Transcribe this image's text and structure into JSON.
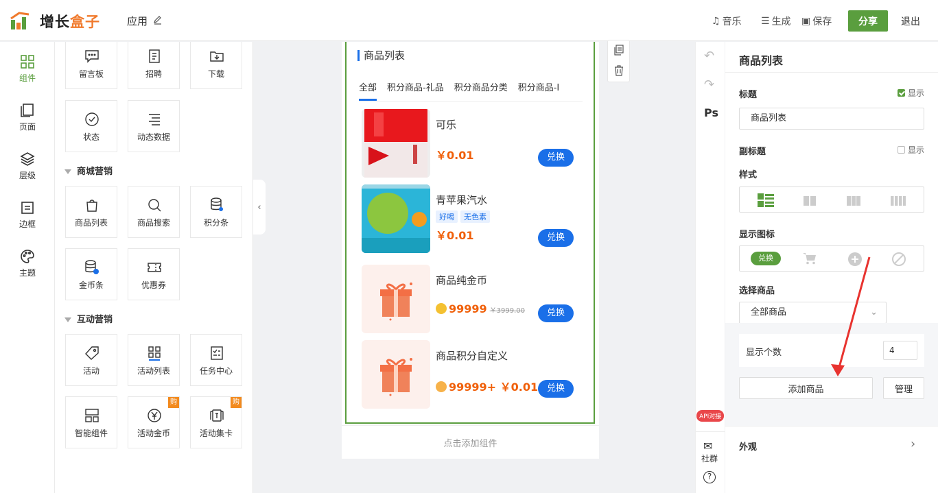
{
  "header": {
    "brand_part1": "增长",
    "brand_part2": "盒子",
    "app_name": "应用",
    "music": "音乐",
    "generate": "生成",
    "save": "保存",
    "share": "分享",
    "exit": "退出"
  },
  "leftnav": {
    "items": [
      {
        "label": "组件"
      },
      {
        "label": "页面"
      },
      {
        "label": "层级"
      },
      {
        "label": "边框"
      },
      {
        "label": "主题"
      }
    ]
  },
  "components": {
    "top": [
      "留言板",
      "招聘",
      "下载",
      "状态",
      "动态数据"
    ],
    "mall_title": "商城营销",
    "mall": [
      "商品列表",
      "商品搜索",
      "积分条",
      "金币条",
      "优惠券"
    ],
    "interact_title": "互动营销",
    "interact": [
      "活动",
      "活动列表",
      "任务中心",
      "智能组件",
      "活动金币",
      "活动集卡"
    ],
    "buy_badge": "购"
  },
  "preview": {
    "title": "商品列表",
    "tabs": [
      "全部",
      "积分商品-礼品",
      "积分商品分类",
      "积分商品-I"
    ],
    "products": [
      {
        "name": "可乐",
        "price": "￥0.01",
        "button": "兑换"
      },
      {
        "name": "青苹果汽水",
        "tags": [
          "好喝",
          "无色素"
        ],
        "price": "￥0.01",
        "button": "兑换"
      },
      {
        "name": "商品纯金币",
        "price": "99999",
        "original": "￥3999.00",
        "button": "兑换"
      },
      {
        "name": "商品积分自定义",
        "price": "99999",
        "price_extra": "+ ￥0.01",
        "button": "兑换"
      }
    ],
    "add_component": "点击添加组件"
  },
  "rightstrip": {
    "ps": "Ps",
    "api": "API对接",
    "community": "社群"
  },
  "props": {
    "panel_title": "商品列表",
    "title_label": "标题",
    "show": "显示",
    "title_value": "商品列表",
    "subtitle_label": "副标题",
    "style_label": "样式",
    "icon_label": "显示图标",
    "icon_redeem": "兑换",
    "select_label": "选择商品",
    "select_value": "全部商品",
    "count_label": "显示个数",
    "count_value": "4",
    "add_btn": "添加商品",
    "manage_btn": "管理",
    "appearance": "外观"
  },
  "colors": {
    "brand_green": "#5a9e3e",
    "accent_blue": "#1a6fe8",
    "price_orange": "#f0600a"
  }
}
